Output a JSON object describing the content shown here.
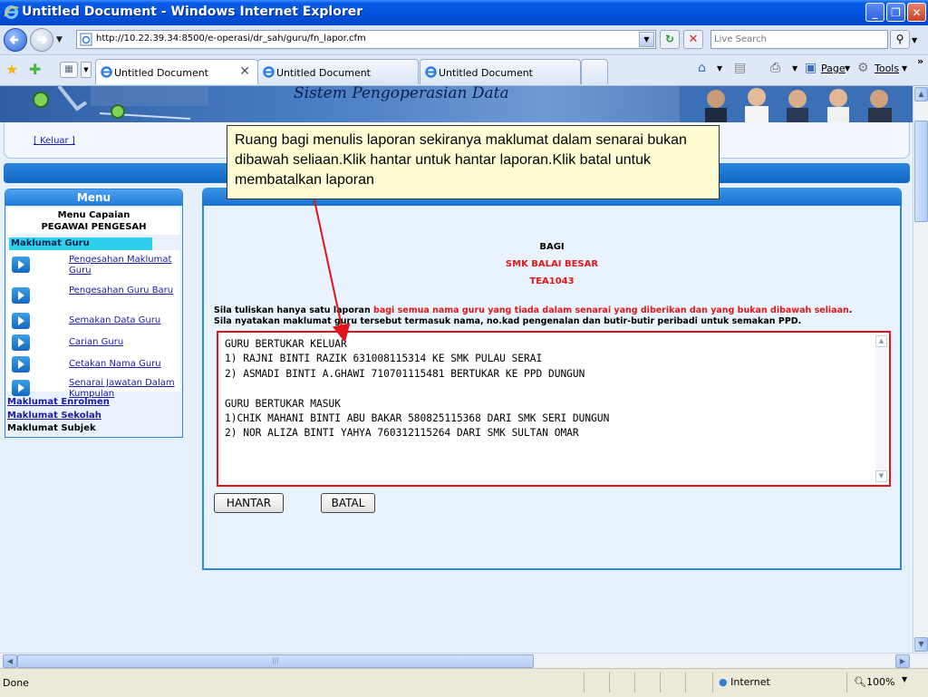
{
  "window": {
    "title": "Untitled Document - Windows Internet Explorer",
    "buttons": {
      "minimize": "_",
      "maximize": "❐",
      "close": "✕"
    }
  },
  "address_bar": {
    "url": "http://10.22.39.34:8500/e-operasi/dr_sah/guru/fn_lapor.cfm",
    "search_placeholder": "Live Search"
  },
  "tabs": [
    {
      "label": "Untitled Document",
      "active": true
    },
    {
      "label": "Untitled Document",
      "active": false
    },
    {
      "label": "Untitled Document",
      "active": false
    }
  ],
  "command_bar": {
    "page": "Page",
    "tools": "Tools",
    "more": "»"
  },
  "banner": {
    "system_title": "Sistem Pengoperasian Data"
  },
  "top_strip": {
    "logout": "[ Keluar ]"
  },
  "menu": {
    "title": "Menu",
    "caption_line1": "Menu Capaian",
    "caption_line2": "PEGAWAI PENGESAH",
    "guru_section": "Maklumat Guru",
    "items": [
      {
        "label": "Pengesahan Maklumat Guru"
      },
      {
        "label": "Pengesahan Guru Baru"
      },
      {
        "label": "Semakan Data Guru"
      },
      {
        "label": "Carian Guru"
      },
      {
        "label": "Cetakan Nama Guru"
      },
      {
        "label": "Senarai Jawatan Dalam Kumpulan"
      }
    ],
    "other_sections": [
      {
        "label": "Maklumat Enrolmen",
        "link": true
      },
      {
        "label": "Maklumat Sekolah",
        "link": true
      },
      {
        "label": "Maklumat Subjek",
        "link": false
      }
    ]
  },
  "panel": {
    "to_label": "BAGI",
    "school_name": "SMK BALAI BESAR",
    "school_code": "TEA1043",
    "instruction_line1_prefix": "Sila tuliskan hanya satu laporan ",
    "instruction_line1_red": "bagi semua nama guru yang tiada dalam senarai yang diberikan dan yang bukan dibawah seliaan",
    "instruction_line1_suffix": ".",
    "instruction_line2": "Sila nyatakan maklumat guru tersebut termasuk nama, no.kad pengenalan dan butir-butir peribadi untuk semakan PPD.",
    "report_text": "GURU BERTUKAR KELUAR\n1) RAJNI BINTI RAZIK 631008115314 KE SMK PULAU SERAI\n2) ASMADI BINTI A.GHAWI 710701115481 BERTUKAR KE PPD DUNGUN\n\nGURU BERTUKAR MASUK\n1)CHIK MAHANI BINTI ABU BAKAR 580825115368 DARI SMK SERI DUNGUN\n2) NOR ALIZA BINTI YAHYA 760312115264 DARI SMK SULTAN OMAR",
    "submit_label": "HANTAR",
    "cancel_label": "BATAL"
  },
  "callout": {
    "text": "Ruang bagi menulis laporan sekiranya maklumat dalam senarai bukan dibawah seliaan.Klik hantar untuk hantar laporan.Klik batal untuk membatalkan laporan"
  },
  "status_bar": {
    "status": "Done",
    "zone": "Internet",
    "zoom": "100%"
  }
}
